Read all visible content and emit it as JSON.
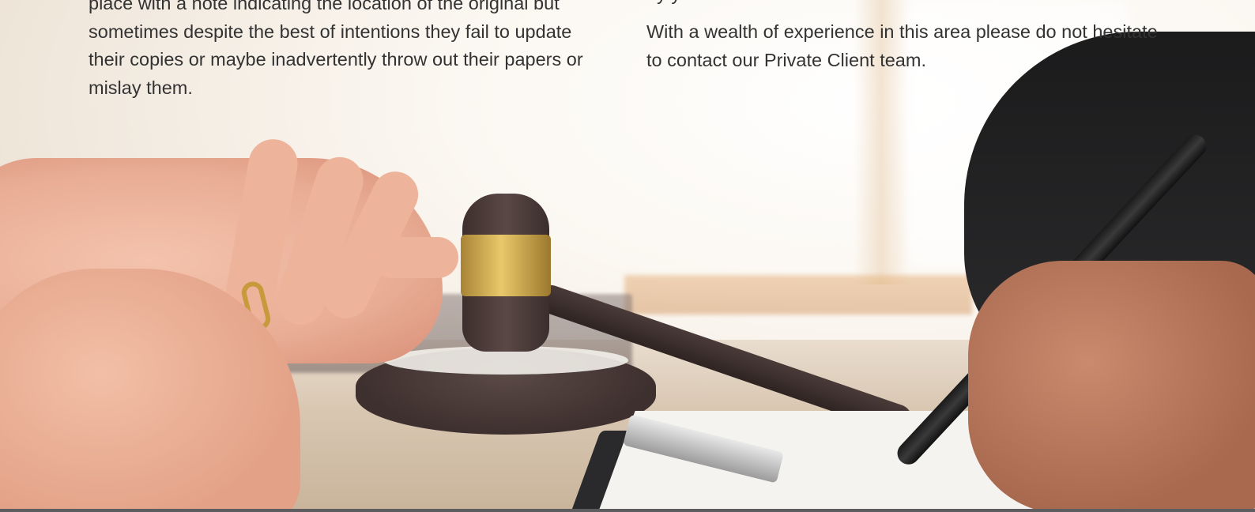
{
  "content": {
    "left_column": {
      "paragraph": "place with a note indicating the location of the original but sometimes despite the best of intentions they fail to update their copies or maybe inadvertently throw out their papers or mislay them."
    },
    "right_column": {
      "partial_line": "by y",
      "paragraph": "With a wealth of experience in this area please do not hesitate to contact our Private Client team."
    }
  },
  "hero_image": {
    "subject": "lawyer-consultation-with-gavel-photo"
  }
}
